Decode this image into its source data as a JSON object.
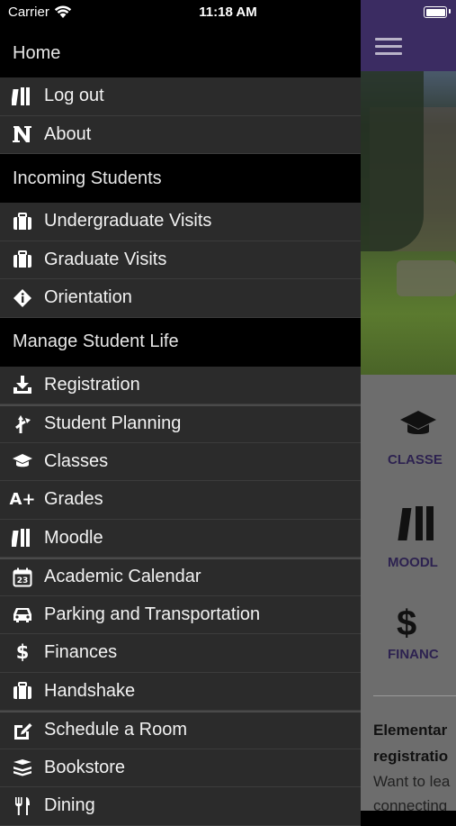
{
  "status_bar": {
    "carrier": "Carrier",
    "time": "11:18 AM"
  },
  "drawer": {
    "sections": [
      {
        "header": "Home",
        "items": [
          {
            "label": "Log out",
            "icon": "books-icon"
          },
          {
            "label": "About",
            "icon": "n-logo-icon"
          }
        ]
      },
      {
        "header": "Incoming Students",
        "items": [
          {
            "label": "Undergraduate Visits",
            "icon": "suitcase-icon"
          },
          {
            "label": "Graduate Visits",
            "icon": "suitcase-icon"
          },
          {
            "label": "Orientation",
            "icon": "info-diamond-icon"
          }
        ]
      },
      {
        "header": "Manage Student Life",
        "items": [
          {
            "label": "Registration",
            "icon": "download-tray-icon"
          },
          {
            "label": "Student Planning",
            "icon": "route-planning-icon"
          },
          {
            "label": "Classes",
            "icon": "graduation-cap-icon"
          },
          {
            "label": "Grades",
            "icon": "a-plus-icon",
            "glyph": "A+"
          },
          {
            "label": "Moodle",
            "icon": "books-icon"
          },
          {
            "label": "Academic Calendar",
            "icon": "calendar-icon",
            "glyph": "23"
          },
          {
            "label": "Parking and Transportation",
            "icon": "car-icon"
          },
          {
            "label": "Finances",
            "icon": "dollar-icon",
            "glyph": "$"
          },
          {
            "label": "Handshake",
            "icon": "suitcase-icon"
          },
          {
            "label": "Schedule a Room",
            "icon": "edit-square-icon"
          },
          {
            "label": "Bookstore",
            "icon": "stacked-books-icon"
          },
          {
            "label": "Dining",
            "icon": "utensils-icon"
          }
        ]
      }
    ]
  },
  "background_app": {
    "tiles": [
      {
        "label": "CLASSE",
        "icon": "graduation-cap-icon"
      },
      {
        "label": "MOODL",
        "icon": "books-icon"
      },
      {
        "label": "FINANC",
        "icon": "dollar-icon",
        "glyph": "$"
      }
    ],
    "news": {
      "title_lines": [
        "Elementar",
        "registratio"
      ],
      "body_lines": [
        "Want to lea",
        "connecting"
      ]
    },
    "colors": {
      "header": "#3b2c62",
      "accent": "#2d2250"
    }
  }
}
